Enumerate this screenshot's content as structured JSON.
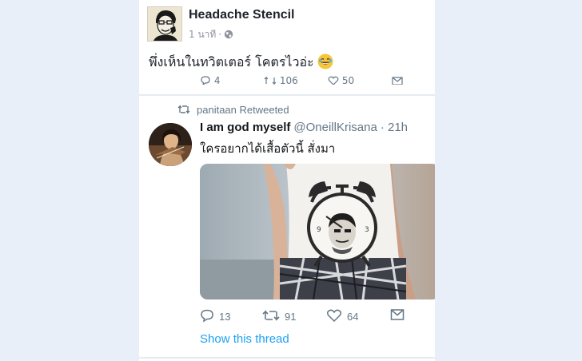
{
  "facebook_post": {
    "author": "Headache Stencil",
    "time": "1 นาที",
    "separator": "·",
    "privacy_icon": "globe-icon",
    "text": "พึ่งเห็นในทวิตเตอร์ โคตรไวอ่ะ",
    "emoji": "😂"
  },
  "tweet": {
    "retweet_label": "panitaan Retweeted",
    "name": "I am god myself",
    "handle": "@OneillKrisana",
    "age": "· 21h",
    "text": "ใครอยากได้เสื้อตัวนี้  สั่งมา",
    "actions": {
      "replies": "13",
      "retweets": "91",
      "likes": "64"
    },
    "show_thread": "Show this thread",
    "previous_counts": {
      "replies": "4",
      "retweets": "106",
      "likes": "50"
    }
  },
  "colors": {
    "link_blue": "#1da1f2",
    "tweet_gray": "#657786",
    "fb_text": "#1d2129",
    "background": "#e9eff8"
  }
}
